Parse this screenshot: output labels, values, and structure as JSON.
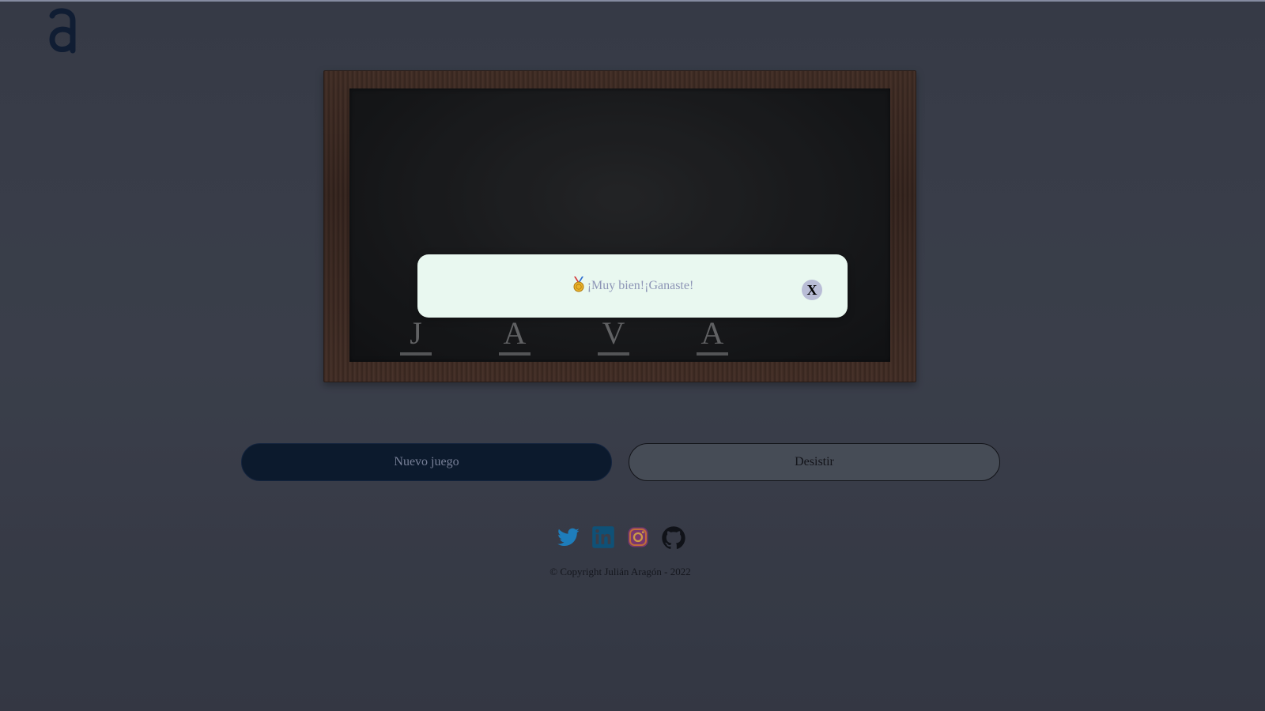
{
  "colors": {
    "background": "#3d414d",
    "primary_button": "#07162b",
    "secondary_button": "#4e535d",
    "modal_background": "#e9f8f0",
    "modal_text": "#8d95b6"
  },
  "logo": {
    "icon": "logo-a-icon"
  },
  "board": {
    "letters": [
      "J",
      "A",
      "V",
      "A"
    ]
  },
  "modal": {
    "icon": "medal-icon",
    "message": "¡Muy bien!¡Ganaste!",
    "close_label": "X"
  },
  "buttons": {
    "new_game": "Nuevo juego",
    "give_up": "Desistir"
  },
  "social": [
    {
      "icon": "twitter-icon"
    },
    {
      "icon": "linkedin-icon"
    },
    {
      "icon": "instagram-icon"
    },
    {
      "icon": "github-icon"
    }
  ],
  "footer": {
    "copyright": "© Copyright Julián Aragón - 2022"
  }
}
